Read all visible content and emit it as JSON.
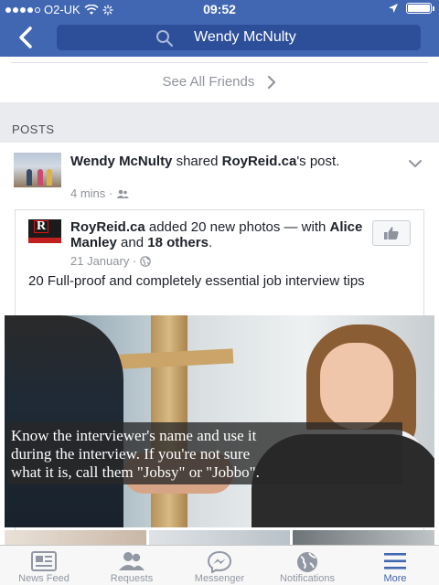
{
  "status_bar": {
    "carrier": "O2-UK",
    "time": "09:52"
  },
  "search": {
    "query": "Wendy McNulty"
  },
  "friends": {
    "see_all_label": "See All Friends"
  },
  "posts_section": {
    "heading": "POSTS"
  },
  "post": {
    "author": "Wendy McNulty",
    "verb": " shared ",
    "source": "RoyReid.ca",
    "suffix": "'s post.",
    "time": "4 mins ·",
    "shared": {
      "page": "RoyReid.ca",
      "action": " added 20 new photos — with ",
      "tag1": "Alice Manley",
      "and": " and ",
      "tag2": "18 others",
      "period": ".",
      "date": "21 January ·",
      "text": "20 Full-proof and completely essential job interview tips",
      "caption_line1": "Know the interviewer's name and use it",
      "caption_line2": "during the interview. If you're not sure",
      "caption_line3": "what it is, call them \"Jobsy\" or \"Jobbo\"."
    }
  },
  "tabs": [
    {
      "label": "News Feed",
      "icon": "news-feed-icon"
    },
    {
      "label": "Requests",
      "icon": "friend-requests-icon"
    },
    {
      "label": "Messenger",
      "icon": "messenger-icon"
    },
    {
      "label": "Notifications",
      "icon": "globe-icon"
    },
    {
      "label": "More",
      "icon": "menu-icon"
    }
  ],
  "colors": {
    "brand": "#4267b2",
    "background": "#e9ebee"
  }
}
